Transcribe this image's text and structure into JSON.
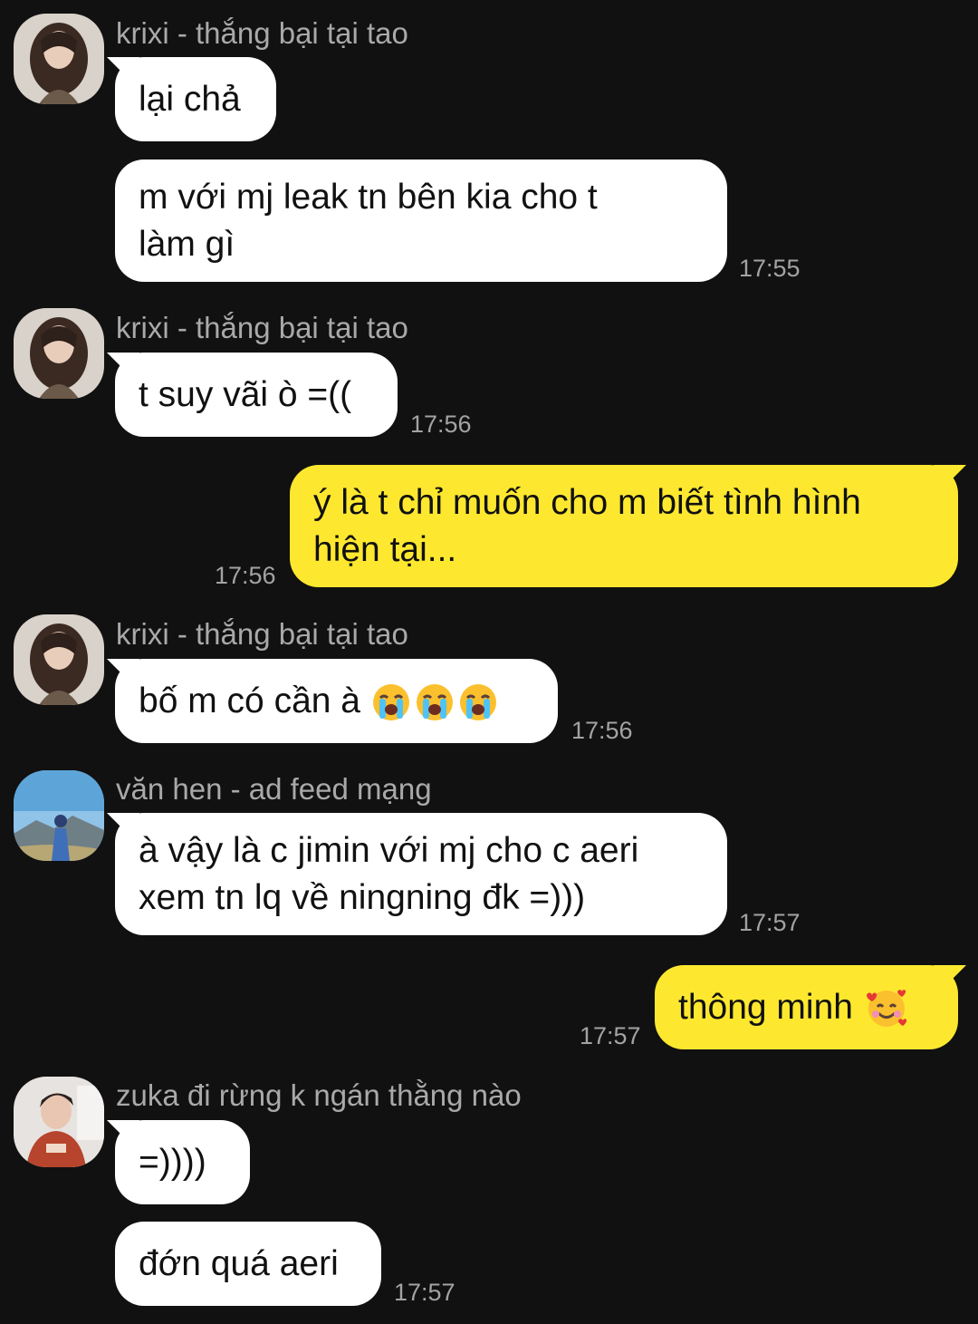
{
  "messages": [
    {
      "sender": "krixi - thắng bại tại tao",
      "text": "lại chả"
    },
    {
      "text_line1": "m với mj leak tn bên kia cho t",
      "text_line2": "làm gì",
      "time": "17:55"
    },
    {
      "sender": "krixi - thắng bại tại tao",
      "text": "t suy vãi ò =((",
      "time": "17:56"
    },
    {
      "text_line1": "ý là t chỉ muốn cho m biết tình hình",
      "text_line2": "hiện tại...",
      "time": "17:56"
    },
    {
      "sender": "krixi - thắng bại tại tao",
      "text": "bố m có cần à",
      "emoji": "loudly-crying-face",
      "time": "17:56"
    },
    {
      "sender": "văn hen - ad feed mạng",
      "text_line1": "à vậy là c jimin với mj cho c aeri",
      "text_line2": "xem tn lq về ningning đk =)))",
      "time": "17:57"
    },
    {
      "text": "thông minh",
      "emoji": "smiling-face-with-hearts",
      "time": "17:57"
    },
    {
      "sender": "zuka đi rừng k ngán thằng nào",
      "text": "=))))"
    },
    {
      "text": "đớn quá aeri",
      "time": "17:57"
    }
  ],
  "colors": {
    "background": "#111111",
    "incoming_bubble": "#ffffff",
    "outgoing_bubble": "#fde82f",
    "sender_name": "#a9a9a9",
    "timestamp": "#a3a3a3"
  }
}
